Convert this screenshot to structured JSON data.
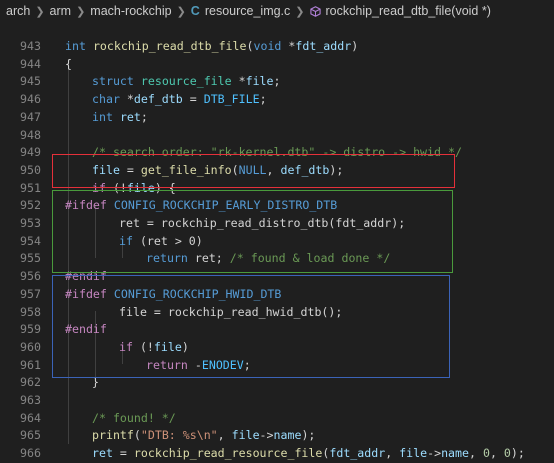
{
  "breadcrumb": {
    "items": [
      "arch",
      "arm",
      "mach-rockchip",
      "resource_img.c",
      "rockchip_read_dtb_file(void *)"
    ],
    "file_icon": "C",
    "icon_names": [
      "c-file-icon",
      "function-icon"
    ]
  },
  "colors": {
    "background": "#1f1f1f",
    "red_box": "#e5303a",
    "green_box": "#4a9a3c",
    "blue_box": "#3b63b8"
  },
  "lines": [
    {
      "n": "943",
      "i": 0,
      "t": [
        [
          "int",
          "kw"
        ],
        [
          " "
        ],
        [
          "rockchip_read_dtb_file",
          "fn"
        ],
        [
          "("
        ],
        [
          "void",
          "kw"
        ],
        [
          " *"
        ],
        [
          "fdt_addr",
          "va"
        ],
        [
          ")"
        ]
      ]
    },
    {
      "n": "944",
      "i": 0,
      "t": [
        [
          "{"
        ]
      ]
    },
    {
      "n": "945",
      "i": 1,
      "t": [
        [
          "struct",
          "kw"
        ],
        [
          " "
        ],
        [
          "resource_file",
          "ty"
        ],
        [
          " *"
        ],
        [
          "file",
          "va"
        ],
        [
          ";"
        ]
      ]
    },
    {
      "n": "946",
      "i": 1,
      "t": [
        [
          "char",
          "kw"
        ],
        [
          " *"
        ],
        [
          "def_dtb",
          "va"
        ],
        [
          " = "
        ],
        [
          "DTB_FILE",
          "mc"
        ],
        [
          ";"
        ]
      ]
    },
    {
      "n": "947",
      "i": 1,
      "t": [
        [
          "int",
          "kw"
        ],
        [
          " "
        ],
        [
          "ret",
          "va"
        ],
        [
          ";"
        ]
      ]
    },
    {
      "n": "948",
      "i": 0,
      "t": []
    },
    {
      "n": "949",
      "i": 1,
      "t": [
        [
          "/* search order: \"rk-kernel.dtb\" -> distro -> hwid */",
          "cm"
        ]
      ]
    },
    {
      "n": "950",
      "i": 1,
      "t": [
        [
          "file",
          "va"
        ],
        [
          " = "
        ],
        [
          "get_file_info",
          "fn"
        ],
        [
          "("
        ],
        [
          "NULL",
          "kw"
        ],
        [
          ", "
        ],
        [
          "def_dtb",
          "va"
        ],
        [
          ");"
        ]
      ]
    },
    {
      "n": "951",
      "i": 1,
      "t": [
        [
          "if",
          "ctl"
        ],
        [
          " (!"
        ],
        [
          "file",
          "va"
        ],
        [
          ") {"
        ]
      ]
    },
    {
      "n": "952",
      "i": 0,
      "t": [
        [
          "#ifdef",
          "pp"
        ],
        [
          " "
        ],
        [
          "CONFIG_ROCKCHIP_EARLY_DISTRO_DTB",
          "df"
        ]
      ]
    },
    {
      "n": "953",
      "i": 2,
      "t": [
        [
          "ret = rockchip_read_distro_dtb(fdt_addr);"
        ]
      ]
    },
    {
      "n": "954",
      "i": 2,
      "t": [
        [
          "if",
          "kw"
        ],
        [
          " (ret > 0)"
        ]
      ]
    },
    {
      "n": "955",
      "i": 3,
      "t": [
        [
          "return",
          "kw"
        ],
        [
          " ret; "
        ],
        [
          "/* found & load done */",
          "cm"
        ]
      ]
    },
    {
      "n": "956",
      "i": 0,
      "t": [
        [
          "#endif",
          "pp"
        ]
      ]
    },
    {
      "n": "957",
      "i": 0,
      "t": [
        [
          "#ifdef",
          "pp"
        ],
        [
          " "
        ],
        [
          "CONFIG_ROCKCHIP_HWID_DTB",
          "df"
        ]
      ]
    },
    {
      "n": "958",
      "i": 2,
      "t": [
        [
          "file = rockchip_read_hwid_dtb();"
        ]
      ]
    },
    {
      "n": "959",
      "i": 0,
      "t": [
        [
          "#endif",
          "pp"
        ]
      ]
    },
    {
      "n": "960",
      "i": 2,
      "t": [
        [
          "if",
          "ctl"
        ],
        [
          " (!"
        ],
        [
          "file",
          "va"
        ],
        [
          ")"
        ]
      ]
    },
    {
      "n": "961",
      "i": 3,
      "t": [
        [
          "return",
          "ctl"
        ],
        [
          " -"
        ],
        [
          "ENODEV",
          "mc"
        ],
        [
          ";"
        ]
      ]
    },
    {
      "n": "962",
      "i": 1,
      "t": [
        [
          "}"
        ]
      ]
    },
    {
      "n": "963",
      "i": 0,
      "t": []
    },
    {
      "n": "964",
      "i": 1,
      "t": [
        [
          "/* found! */",
          "cm"
        ]
      ]
    },
    {
      "n": "965",
      "i": 1,
      "t": [
        [
          "printf",
          "fn"
        ],
        [
          "("
        ],
        [
          "\"DTB: %s\\n\"",
          "st"
        ],
        [
          ", "
        ],
        [
          "file",
          "va"
        ],
        [
          "->"
        ],
        [
          "name",
          "va"
        ],
        [
          ");"
        ]
      ]
    },
    {
      "n": "966",
      "i": 1,
      "t": [
        [
          "ret",
          "va"
        ],
        [
          " = "
        ],
        [
          "rockchip_read_resource_file",
          "fn"
        ],
        [
          "("
        ],
        [
          "fdt_addr",
          "va"
        ],
        [
          ", "
        ],
        [
          "file",
          "va"
        ],
        [
          "->"
        ],
        [
          "name",
          "va"
        ],
        [
          ", "
        ],
        [
          "0",
          "nu"
        ],
        [
          ", "
        ],
        [
          "0",
          "nu"
        ],
        [
          ");"
        ]
      ]
    }
  ]
}
